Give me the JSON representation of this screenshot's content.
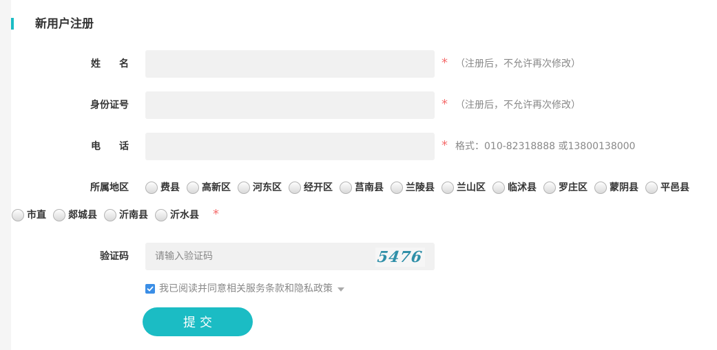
{
  "section": {
    "title": "新用户注册"
  },
  "name": {
    "label": "姓名",
    "value": "",
    "required": "*",
    "hint": "（注册后，不允许再次修改）"
  },
  "id_number": {
    "label": "身份证号",
    "value": "",
    "required": "*",
    "hint": "（注册后，不允许再次修改）"
  },
  "phone": {
    "label": "电话",
    "value": "",
    "required": "*",
    "hint": "格式：010-82318888 或13800138000"
  },
  "region": {
    "label": "所属地区",
    "required": "*",
    "options": [
      "费县",
      "高新区",
      "河东区",
      "经开区",
      "莒南县",
      "兰陵县",
      "兰山区",
      "临沭县",
      "罗庄区",
      "蒙阴县",
      "平邑县",
      "市直",
      "郯城县",
      "沂南县",
      "沂水县"
    ]
  },
  "captcha": {
    "label": "验证码",
    "placeholder": "请输入验证码",
    "code": "5476"
  },
  "agreement": {
    "checked": true,
    "text": "我已阅读并同意相关服务条款和隐私政策"
  },
  "submit": {
    "label": "提交"
  },
  "colors": {
    "accent": "#1bbcc4",
    "required": "#f56c6c",
    "checkbox": "#3b8ee6"
  }
}
